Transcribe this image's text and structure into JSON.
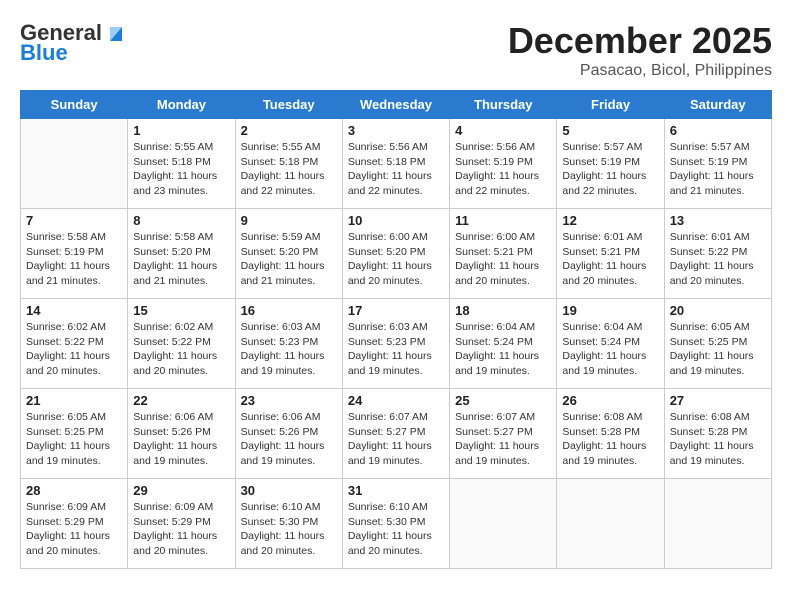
{
  "header": {
    "logo": {
      "general": "General",
      "blue": "Blue"
    },
    "title": "December 2025",
    "location": "Pasacao, Bicol, Philippines"
  },
  "weekdays": [
    "Sunday",
    "Monday",
    "Tuesday",
    "Wednesday",
    "Thursday",
    "Friday",
    "Saturday"
  ],
  "weeks": [
    [
      {
        "day": "",
        "info": ""
      },
      {
        "day": "1",
        "info": "Sunrise: 5:55 AM\nSunset: 5:18 PM\nDaylight: 11 hours\nand 23 minutes."
      },
      {
        "day": "2",
        "info": "Sunrise: 5:55 AM\nSunset: 5:18 PM\nDaylight: 11 hours\nand 22 minutes."
      },
      {
        "day": "3",
        "info": "Sunrise: 5:56 AM\nSunset: 5:18 PM\nDaylight: 11 hours\nand 22 minutes."
      },
      {
        "day": "4",
        "info": "Sunrise: 5:56 AM\nSunset: 5:19 PM\nDaylight: 11 hours\nand 22 minutes."
      },
      {
        "day": "5",
        "info": "Sunrise: 5:57 AM\nSunset: 5:19 PM\nDaylight: 11 hours\nand 22 minutes."
      },
      {
        "day": "6",
        "info": "Sunrise: 5:57 AM\nSunset: 5:19 PM\nDaylight: 11 hours\nand 21 minutes."
      }
    ],
    [
      {
        "day": "7",
        "info": "Sunrise: 5:58 AM\nSunset: 5:19 PM\nDaylight: 11 hours\nand 21 minutes."
      },
      {
        "day": "8",
        "info": "Sunrise: 5:58 AM\nSunset: 5:20 PM\nDaylight: 11 hours\nand 21 minutes."
      },
      {
        "day": "9",
        "info": "Sunrise: 5:59 AM\nSunset: 5:20 PM\nDaylight: 11 hours\nand 21 minutes."
      },
      {
        "day": "10",
        "info": "Sunrise: 6:00 AM\nSunset: 5:20 PM\nDaylight: 11 hours\nand 20 minutes."
      },
      {
        "day": "11",
        "info": "Sunrise: 6:00 AM\nSunset: 5:21 PM\nDaylight: 11 hours\nand 20 minutes."
      },
      {
        "day": "12",
        "info": "Sunrise: 6:01 AM\nSunset: 5:21 PM\nDaylight: 11 hours\nand 20 minutes."
      },
      {
        "day": "13",
        "info": "Sunrise: 6:01 AM\nSunset: 5:22 PM\nDaylight: 11 hours\nand 20 minutes."
      }
    ],
    [
      {
        "day": "14",
        "info": "Sunrise: 6:02 AM\nSunset: 5:22 PM\nDaylight: 11 hours\nand 20 minutes."
      },
      {
        "day": "15",
        "info": "Sunrise: 6:02 AM\nSunset: 5:22 PM\nDaylight: 11 hours\nand 20 minutes."
      },
      {
        "day": "16",
        "info": "Sunrise: 6:03 AM\nSunset: 5:23 PM\nDaylight: 11 hours\nand 19 minutes."
      },
      {
        "day": "17",
        "info": "Sunrise: 6:03 AM\nSunset: 5:23 PM\nDaylight: 11 hours\nand 19 minutes."
      },
      {
        "day": "18",
        "info": "Sunrise: 6:04 AM\nSunset: 5:24 PM\nDaylight: 11 hours\nand 19 minutes."
      },
      {
        "day": "19",
        "info": "Sunrise: 6:04 AM\nSunset: 5:24 PM\nDaylight: 11 hours\nand 19 minutes."
      },
      {
        "day": "20",
        "info": "Sunrise: 6:05 AM\nSunset: 5:25 PM\nDaylight: 11 hours\nand 19 minutes."
      }
    ],
    [
      {
        "day": "21",
        "info": "Sunrise: 6:05 AM\nSunset: 5:25 PM\nDaylight: 11 hours\nand 19 minutes."
      },
      {
        "day": "22",
        "info": "Sunrise: 6:06 AM\nSunset: 5:26 PM\nDaylight: 11 hours\nand 19 minutes."
      },
      {
        "day": "23",
        "info": "Sunrise: 6:06 AM\nSunset: 5:26 PM\nDaylight: 11 hours\nand 19 minutes."
      },
      {
        "day": "24",
        "info": "Sunrise: 6:07 AM\nSunset: 5:27 PM\nDaylight: 11 hours\nand 19 minutes."
      },
      {
        "day": "25",
        "info": "Sunrise: 6:07 AM\nSunset: 5:27 PM\nDaylight: 11 hours\nand 19 minutes."
      },
      {
        "day": "26",
        "info": "Sunrise: 6:08 AM\nSunset: 5:28 PM\nDaylight: 11 hours\nand 19 minutes."
      },
      {
        "day": "27",
        "info": "Sunrise: 6:08 AM\nSunset: 5:28 PM\nDaylight: 11 hours\nand 19 minutes."
      }
    ],
    [
      {
        "day": "28",
        "info": "Sunrise: 6:09 AM\nSunset: 5:29 PM\nDaylight: 11 hours\nand 20 minutes."
      },
      {
        "day": "29",
        "info": "Sunrise: 6:09 AM\nSunset: 5:29 PM\nDaylight: 11 hours\nand 20 minutes."
      },
      {
        "day": "30",
        "info": "Sunrise: 6:10 AM\nSunset: 5:30 PM\nDaylight: 11 hours\nand 20 minutes."
      },
      {
        "day": "31",
        "info": "Sunrise: 6:10 AM\nSunset: 5:30 PM\nDaylight: 11 hours\nand 20 minutes."
      },
      {
        "day": "",
        "info": ""
      },
      {
        "day": "",
        "info": ""
      },
      {
        "day": "",
        "info": ""
      }
    ]
  ]
}
